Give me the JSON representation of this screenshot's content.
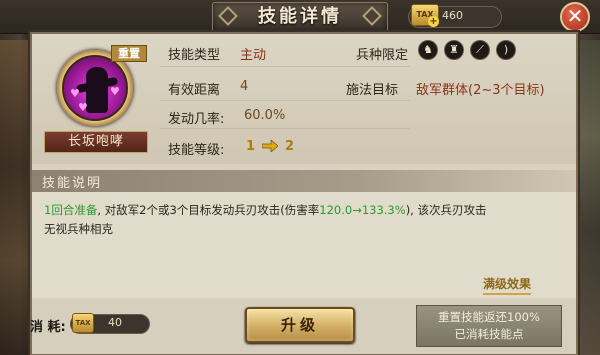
{
  "header": {
    "title": "技能详情",
    "gold_icon_label": "TAX",
    "gold_value": "460",
    "close_label": "✕"
  },
  "skill": {
    "name": "长坂咆哮",
    "dupe_tag": "重置",
    "type_label": "技能类型",
    "type_value": "主动",
    "troop_label": "兵种限定",
    "range_label": "有效距离",
    "range_value": "4",
    "target_label": "施法目标",
    "target_value": "敌军群体(2~3个目标)",
    "rate_label": "发动几率:",
    "rate_value": "60.0%",
    "level_label": "技能等级:",
    "level_from": "1",
    "level_to": "2"
  },
  "troop_icons": [
    "horse-icon",
    "shield-icon",
    "spear-icon",
    "bow-icon"
  ],
  "description": {
    "header": "技能说明",
    "line1_prefix": "1回合准备",
    "line1_mid": ", 对敌军2个或3个目标发动兵刃攻击(伤害率",
    "line1_rate": "120.0→133.3%",
    "line1_suffix": "), 该次兵刃攻击",
    "line2": "无视兵种相克",
    "full_effect": "满级效果"
  },
  "footer": {
    "cost_label": "消 耗:",
    "cost_icon_label": "TAX",
    "cost_value": "40",
    "upgrade_label": "升级",
    "reset_line1": "重置技能返还100%",
    "reset_line2": "已消耗技能点"
  },
  "colors": {
    "panel": "#d9d2c1",
    "highlight_green": "#2a9c2a",
    "accent_gold": "#d6b36a"
  }
}
